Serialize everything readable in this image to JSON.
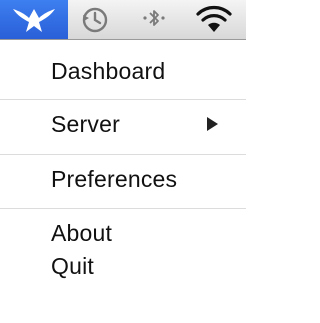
{
  "menubar": {
    "icons": [
      "app-logo-icon",
      "time-machine-icon",
      "bluetooth-icon",
      "wifi-icon"
    ]
  },
  "menu": {
    "dashboard": "Dashboard",
    "server": "Server",
    "server_submenu_icon": "submenu-arrow-icon",
    "preferences": "Preferences",
    "about": "About",
    "quit": "Quit"
  },
  "colors": {
    "highlight": "#2f6be0",
    "menubar": "#e2e2e2",
    "separator": "#dcdcdc",
    "text": "#111111"
  }
}
